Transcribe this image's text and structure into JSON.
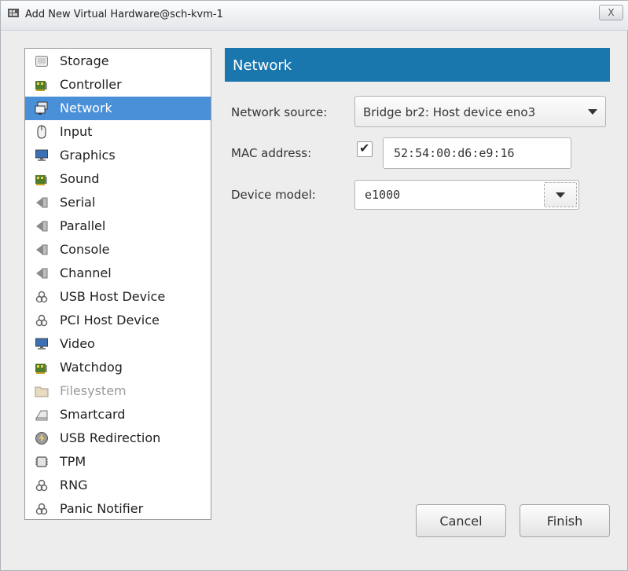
{
  "window": {
    "title": "Add New Virtual Hardware@sch-kvm-1",
    "close_label": "X",
    "close_icon": "close-icon",
    "title_icon": "virt-manager-icon"
  },
  "sidebar": {
    "items": [
      {
        "label": "Storage",
        "icon": "storage-icon"
      },
      {
        "label": "Controller",
        "icon": "controller-icon"
      },
      {
        "label": "Network",
        "icon": "network-icon"
      },
      {
        "label": "Input",
        "icon": "mouse-icon"
      },
      {
        "label": "Graphics",
        "icon": "monitor-icon"
      },
      {
        "label": "Sound",
        "icon": "sound-card-icon"
      },
      {
        "label": "Serial",
        "icon": "serial-port-icon"
      },
      {
        "label": "Parallel",
        "icon": "parallel-port-icon"
      },
      {
        "label": "Console",
        "icon": "console-port-icon"
      },
      {
        "label": "Channel",
        "icon": "channel-port-icon"
      },
      {
        "label": "USB Host Device",
        "icon": "usb-host-device-icon"
      },
      {
        "label": "PCI Host Device",
        "icon": "pci-host-device-icon"
      },
      {
        "label": "Video",
        "icon": "video-icon"
      },
      {
        "label": "Watchdog",
        "icon": "watchdog-icon"
      },
      {
        "label": "Filesystem",
        "icon": "folder-icon"
      },
      {
        "label": "Smartcard",
        "icon": "smartcard-icon"
      },
      {
        "label": "USB Redirection",
        "icon": "usb-redirection-icon"
      },
      {
        "label": "TPM",
        "icon": "tpm-chip-icon"
      },
      {
        "label": "RNG",
        "icon": "rng-icon"
      },
      {
        "label": "Panic Notifier",
        "icon": "panic-notifier-icon"
      }
    ],
    "selected": "Network",
    "disabled": [
      "Filesystem"
    ]
  },
  "panel": {
    "header": "Network",
    "network_source_label": "Network source:",
    "network_source_value": "Bridge br2: Host device eno3",
    "mac_label": "MAC address:",
    "mac_checked": true,
    "mac_value": "52:54:00:d6:e9:16",
    "device_model_label": "Device model:",
    "device_model_value": "e1000"
  },
  "buttons": {
    "cancel": "Cancel",
    "finish": "Finish"
  },
  "colors": {
    "accent_header": "#1a77ad",
    "selection": "#4a90d9"
  }
}
